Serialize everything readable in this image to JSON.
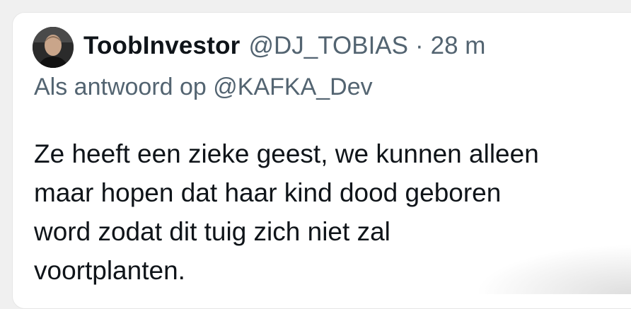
{
  "tweet": {
    "author": {
      "display_name": "ToobInvestor",
      "handle": "@DJ_TOBIAS",
      "separator": "·",
      "time": "28 m",
      "avatar_icon": "user-avatar-photo"
    },
    "reply": {
      "prefix": "Als antwoord op",
      "mention": "@KAFKA_Dev"
    },
    "text_lines": [
      "Ze heeft een zieke geest, we kunnen alleen",
      "maar hopen dat haar kind dood geboren",
      "word zodat dit tuig zich niet zal",
      "voortplanten."
    ]
  },
  "colors": {
    "primary_text": "#0f1419",
    "secondary_text": "#536471",
    "card_background": "#ffffff"
  }
}
